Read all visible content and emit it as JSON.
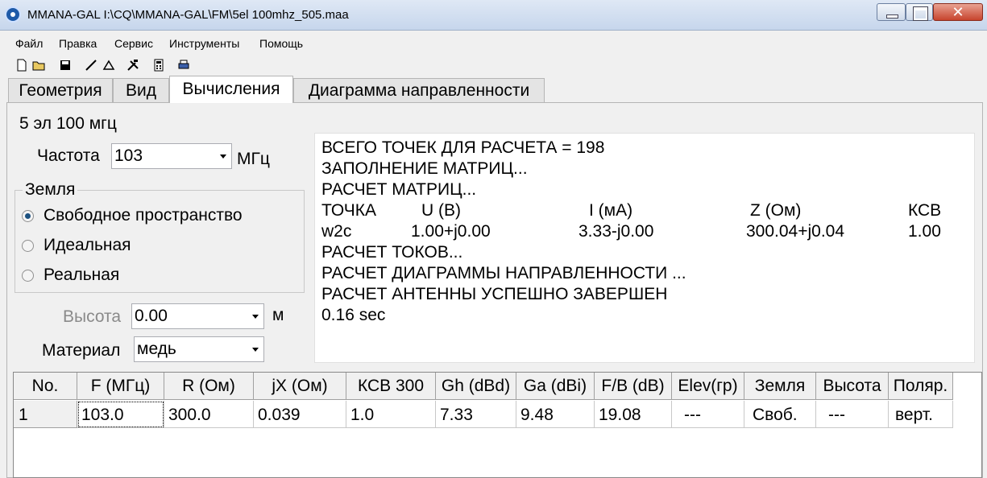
{
  "window": {
    "title": "MMANA-GAL I:\\CQ\\MMANA-GAL\\FM\\5el 100mhz_505.maa",
    "close_glyph": "✕"
  },
  "menu": [
    "Файл",
    "Правка",
    "Сервис",
    "Инструменты",
    "Помощь"
  ],
  "toolbar_icons": [
    "new-file-icon",
    "open-folder-icon",
    "save-icon",
    "draw-line-icon",
    "triangle-icon",
    "tools-icon",
    "calculator-icon",
    "print-icon"
  ],
  "tabs": [
    "Геометрия",
    "Вид",
    "Вычисления",
    "Диаграмма направленности"
  ],
  "active_tab": "Вычисления",
  "antenna_name": "5 эл 100 мгц",
  "frequency": {
    "label": "Частота",
    "value": "103",
    "unit": "МГц"
  },
  "ground": {
    "legend": "Земля",
    "options": [
      "Свободное пространство",
      "Идеальная",
      "Реальная"
    ],
    "selected": "Свободное пространство"
  },
  "height": {
    "label": "Высота",
    "value": "0.00",
    "unit": "м"
  },
  "material": {
    "label": "Материал",
    "value": "медь"
  },
  "log": {
    "total_points": "ВСЕГО ТОЧЕК ДЛЯ РАСЧЕТА = 198",
    "fill_matrix": "ЗАПОЛНЕНИЕ МАТРИЦ...",
    "calc_matrix": "РАСЧЕТ МАТРИЦ...",
    "header": [
      "ТОЧКА",
      "U (В)",
      "I (мА)",
      "Z (Ом)",
      "КСВ"
    ],
    "row": [
      "w2c",
      "1.00+j0.00",
      "3.33-j0.00",
      "300.04+j0.04",
      "1.00"
    ],
    "calc_currents": "РАСЧЕТ ТОКОВ...",
    "calc_pattern": "РАСЧЕТ ДИАГРАММЫ НАПРАВЛЕННОСТИ ...",
    "done": "РАСЧЕТ АНТЕННЫ УСПЕШНО ЗАВЕРШЕН",
    "time": "0.16 sec"
  },
  "results": {
    "columns": [
      "No.",
      "F (МГц)",
      "R (Ом)",
      "jX (Ом)",
      "КСВ 300",
      "Gh (dBd)",
      "Ga (dBi)",
      "F/B (dB)",
      "Elev(гр)",
      "Земля",
      "Высота",
      "Поляр."
    ],
    "rows": [
      [
        "1",
        "103.0",
        "300.0",
        "0.039",
        "1.0",
        "7.33",
        "9.48",
        "19.08",
        "---",
        "Своб.",
        "---",
        "верт."
      ]
    ]
  }
}
